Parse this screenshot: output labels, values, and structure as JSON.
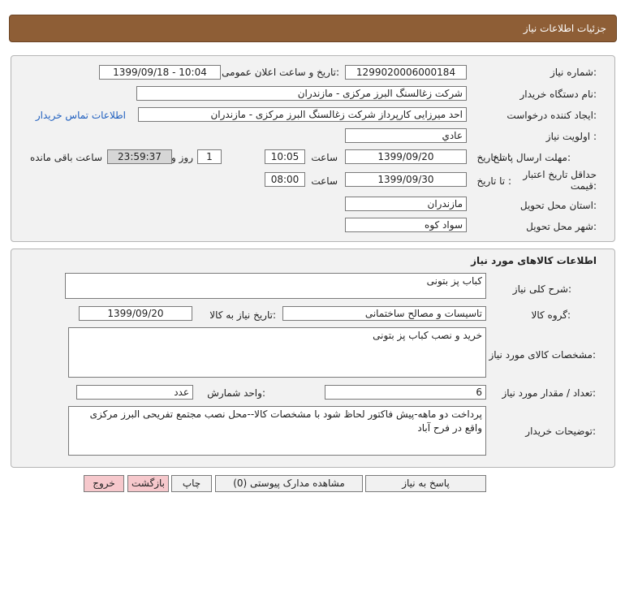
{
  "header": {
    "title": "جزئیات اطلاعات نیاز"
  },
  "need": {
    "number_label": "شماره نیاز:",
    "number_value": "1299020006000184",
    "announce_label": "تاریخ و ساعت اعلان عمومی:",
    "announce_value": "1399/09/18 - 10:04",
    "buyer_label": "نام دستگاه خریدار:",
    "buyer_value": "شرکت زغالسنگ البرز مرکزی - مازندران",
    "creator_label": "ایجاد کننده درخواست:",
    "creator_value": "احد میرزایی کارپرداز شرکت زغالسنگ البرز مرکزی - مازندران",
    "contact_link": "اطلاعات تماس خریدار",
    "priority_label": "اولویت نیاز :",
    "priority_value": "عادي",
    "deadline_label": "مهلت ارسال پاسخ:",
    "until_date_label": "تا تاریخ :",
    "deadline_date": "1399/09/20",
    "time_label": "ساعت",
    "deadline_time": "10:05",
    "days_value": "1",
    "days_label": "روز و",
    "remaining_value": "23:59:37",
    "remaining_label": "ساعت باقی مانده",
    "validity_label": "حداقل تاریخ اعتبار قیمت:",
    "validity_date": "1399/09/30",
    "validity_time": "08:00",
    "province_label": "استان محل تحویل:",
    "province_value": "مازندران",
    "city_label": "شهر محل تحویل:",
    "city_value": "سواد کوه"
  },
  "goods": {
    "section_title": "اطلاعات کالاهای مورد نیاز",
    "summary_label": "شرح کلی نیاز:",
    "summary_value": "کباب پز بتونی",
    "group_label": "گروه کالا:",
    "group_value": "تاسیسات و مصالح ساختمانی",
    "need_date_label": "تاریخ نیاز به کالا:",
    "need_date_value": "1399/09/20",
    "specs_label": "مشخصات کالای مورد نیاز:",
    "specs_value": "خرید و نصب کباب پز بتونی",
    "qty_label": "تعداد / مقدار مورد نیاز:",
    "qty_value": "6",
    "unit_label": "واحد شمارش:",
    "unit_value": "عدد",
    "notes_label": "توضیحات خریدار:",
    "notes_value": "پرداخت دو ماهه-پیش فاکتور لحاظ شود با مشخصات کالا--محل نصب مجتمع تفریحی البرز مرکزی واقع در فرح آباد"
  },
  "actions": {
    "reply": "پاسخ به نیاز",
    "attachments": "مشاهده مدارک پیوستی (0)",
    "print": "چاپ",
    "back": "بازگشت",
    "exit": "خروج"
  }
}
